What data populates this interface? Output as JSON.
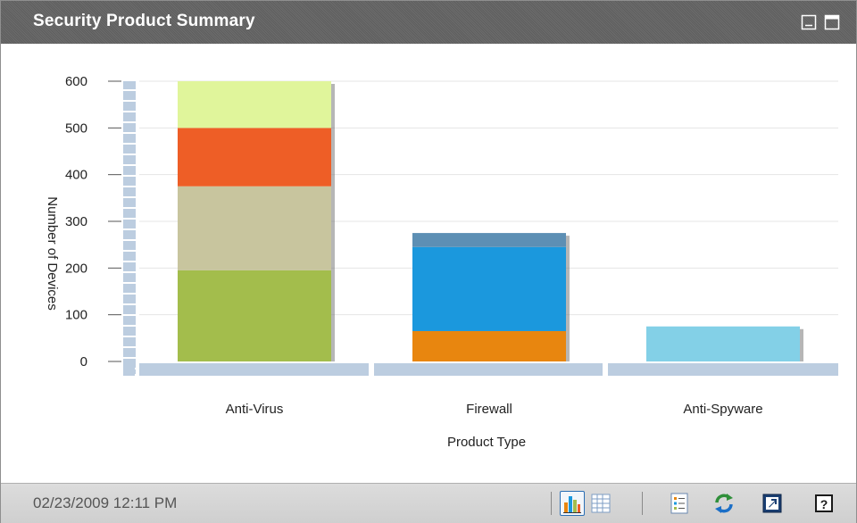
{
  "panel": {
    "title": "Security Product Summary",
    "window_controls": [
      "minimize-icon",
      "maximize-icon"
    ]
  },
  "chart_data": {
    "type": "bar",
    "stacked": true,
    "categories": [
      "Anti-Virus",
      "Firewall",
      "Anti-Spyware"
    ],
    "series": [
      {
        "category": "Anti-Virus",
        "segments": [
          {
            "value": 195,
            "color": "#a3bd4c"
          },
          {
            "value": 180,
            "color": "#c8c59e"
          },
          {
            "value": 125,
            "color": "#ee5e26"
          },
          {
            "value": 100,
            "color": "#e0f59b"
          }
        ]
      },
      {
        "category": "Firewall",
        "segments": [
          {
            "value": 65,
            "color": "#e8860f"
          },
          {
            "value": 180,
            "color": "#1b98dd"
          },
          {
            "value": 30,
            "color": "#5d8fb4"
          }
        ]
      },
      {
        "category": "Anti-Spyware",
        "segments": [
          {
            "value": 75,
            "color": "#83d0e7"
          }
        ]
      }
    ],
    "xlabel": "Product Type",
    "ylabel": "Number of Devices",
    "ylim": [
      0,
      600
    ],
    "yticks": [
      "0",
      "100",
      "200",
      "300",
      "400",
      "500",
      "600"
    ],
    "grid": true,
    "legend": "none"
  },
  "footer": {
    "timestamp": "02/23/2009 12:11 PM",
    "buttons": [
      "bar-chart-icon",
      "table-view-icon",
      "details-list-icon",
      "refresh-icon",
      "open-external-icon",
      "help-icon"
    ]
  }
}
